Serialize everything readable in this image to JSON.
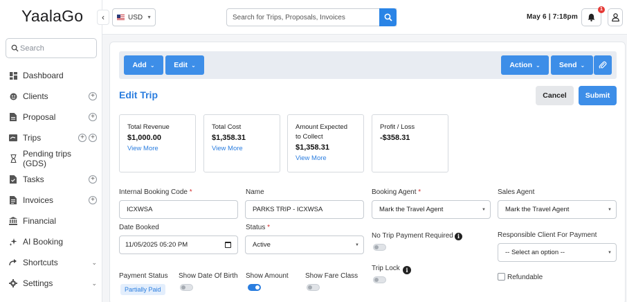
{
  "app": {
    "logo": "YaalaGo"
  },
  "sidebar": {
    "search_placeholder": "Search",
    "items": [
      {
        "label": "Dashboard",
        "icon": "dashboard-icon"
      },
      {
        "label": "Clients",
        "icon": "clients-icon"
      },
      {
        "label": "Proposal",
        "icon": "document-icon"
      },
      {
        "label": "Trips",
        "icon": "ticket-icon"
      },
      {
        "label": "Pending trips (GDS)",
        "icon": "hourglass-icon"
      },
      {
        "label": "Tasks",
        "icon": "tasks-icon"
      },
      {
        "label": "Invoices",
        "icon": "invoice-icon"
      },
      {
        "label": "Financial",
        "icon": "bank-icon"
      },
      {
        "label": "AI Booking",
        "icon": "sparkle-icon"
      },
      {
        "label": "Shortcuts",
        "icon": "shortcut-icon"
      },
      {
        "label": "Settings",
        "icon": "gear-icon"
      }
    ]
  },
  "topbar": {
    "currency": "USD",
    "search_placeholder": "Search for Trips, Proposals, Invoices",
    "datetime": "May 6 | 7:18pm",
    "notification_count": "1"
  },
  "toolbar": {
    "add": "Add",
    "edit": "Edit",
    "action": "Action",
    "send": "Send"
  },
  "page": {
    "title": "Edit Trip",
    "cancel": "Cancel",
    "submit": "Submit"
  },
  "stats": [
    {
      "label": "Total Revenue",
      "value": "$1,000.00",
      "link": "View More"
    },
    {
      "label": "Total Cost",
      "value": "$1,358.31",
      "link": "View More"
    },
    {
      "label": "Amount Expected to Collect",
      "value": "$1,358.31",
      "link": "View More"
    },
    {
      "label": "Profit / Loss",
      "value": "-$358.31",
      "link": ""
    }
  ],
  "form": {
    "booking_code_label": "Internal Booking Code",
    "booking_code": "ICXWSA",
    "name_label": "Name",
    "name": "PARKS TRIP - ICXWSA",
    "booking_agent_label": "Booking Agent",
    "booking_agent": "Mark the Travel Agent",
    "sales_agent_label": "Sales Agent",
    "sales_agent": "Mark the Travel Agent",
    "date_booked_label": "Date Booked",
    "date_booked": "11/05/2025 05:20 PM",
    "status_label": "Status",
    "status": "Active",
    "no_trip_payment_label": "No Trip Payment Required",
    "responsible_client_label": "Responsible Client For Payment",
    "responsible_client": "-- Select an option --",
    "payment_status_label": "Payment Status",
    "payment_status": "Partially Paid",
    "show_dob_label": "Show Date Of Birth",
    "show_amount_label": "Show Amount",
    "show_fare_class_label": "Show Fare Class",
    "trip_lock_label": "Trip Lock",
    "refundable_label": "Refundable",
    "required_mark": "*"
  }
}
